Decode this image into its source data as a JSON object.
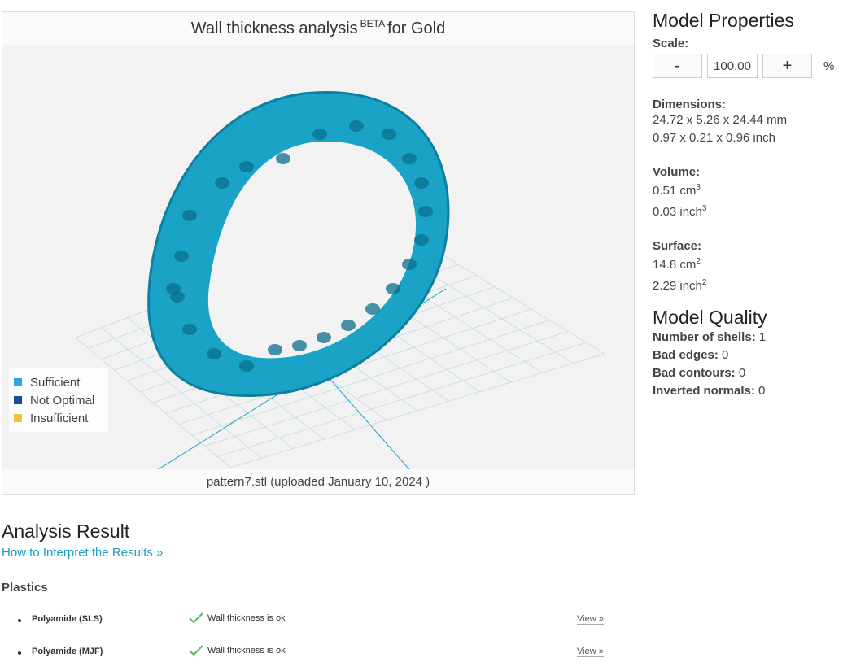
{
  "viewer": {
    "title": "Wall thickness analysis",
    "title_sup": "BETA",
    "title_suffix": "for Gold",
    "footer": "pattern7.stl (uploaded January 10, 2024 )",
    "legend": [
      {
        "label": "Sufficient",
        "color": "#29a8e0"
      },
      {
        "label": "Not Optimal",
        "color": "#1a4f8f"
      },
      {
        "label": "Insufficient",
        "color": "#f0c33c"
      }
    ],
    "model_color": "#1aa3c6",
    "grid_color": "#c9dfe8"
  },
  "properties": {
    "heading": "Model Properties",
    "scale_label": "Scale:",
    "minus_label": "-",
    "scale_value": "100.00",
    "plus_label": "+",
    "percent": "%",
    "dimensions_label": "Dimensions:",
    "dimensions_mm": "24.72 x 5.26 x 24.44 mm",
    "dimensions_inch": "0.97 x 0.21 x 0.96 inch",
    "volume_label": "Volume:",
    "volume_cm": "0.51 cm",
    "volume_inch": "0.03 inch",
    "surface_label": "Surface:",
    "surface_cm": "14.8 cm",
    "surface_inch": "2.29 inch",
    "sup3": "3",
    "sup2": "2"
  },
  "quality": {
    "heading": "Model Quality",
    "rows": [
      {
        "label": "Number of shells:",
        "value": "1"
      },
      {
        "label": "Bad edges:",
        "value": "0"
      },
      {
        "label": "Bad contours:",
        "value": "0"
      },
      {
        "label": "Inverted normals:",
        "value": "0"
      }
    ]
  },
  "analysis": {
    "heading": "Analysis Result",
    "interpret_link": "How to Interpret the Results »",
    "section": "Plastics",
    "results": [
      {
        "material": "Polyamide (SLS)",
        "status": "Wall thickness is ok",
        "view": "View »"
      },
      {
        "material": "Polyamide (MJF)",
        "status": "Wall thickness is ok",
        "view": "View »"
      }
    ],
    "ok_color": "#5cb85c"
  }
}
